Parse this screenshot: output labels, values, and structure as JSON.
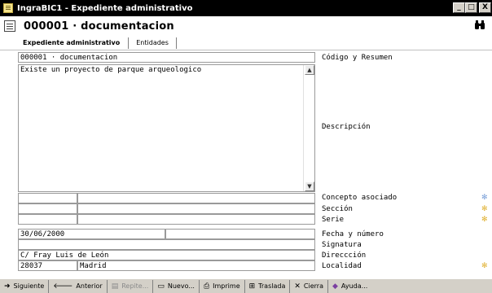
{
  "window": {
    "title": "IngraBIC1 - Expediente administrativo",
    "buttons": [
      "_",
      "□",
      "X"
    ]
  },
  "header": {
    "title": "000001 · documentacion",
    "search_icon": "binoculars-icon"
  },
  "tabs": [
    {
      "label": "Expediente administrativo",
      "active": true
    },
    {
      "label": "Entidades",
      "active": false
    }
  ],
  "fields": {
    "codigo_resumen": "000001 · documentacion",
    "descripcion": "Existe un proyecto de parque arqueologico",
    "concepto_a": "",
    "concepto_b": "",
    "seccion_a": "",
    "seccion_b": "",
    "serie_a": "",
    "serie_b": "",
    "fecha": "30/06/2000",
    "numero": "",
    "signatura": "",
    "direccion": "C/ Fray Luis de León",
    "cp": "28037",
    "localidad": "Madrid"
  },
  "labels": {
    "codigo_resumen": "Código y Resumen",
    "descripcion": "Descripción",
    "concepto": "Concepto asociado",
    "seccion": "Sección",
    "serie": "Serie",
    "fecha": "Fecha y número",
    "signatura": "Signatura",
    "direccion": "Direccción",
    "localidad": "Localidad"
  },
  "toolbar": [
    {
      "label": "Siguiente",
      "icon": "arrow-right-icon",
      "glyph": "➜",
      "disabled": false
    },
    {
      "label": "Anterior",
      "icon": "arrow-left-icon",
      "glyph": "🡐",
      "disabled": false
    },
    {
      "label": "Repite...",
      "icon": "repeat-icon",
      "glyph": "▤",
      "disabled": true
    },
    {
      "label": "Nuevo...",
      "icon": "new-icon",
      "glyph": "▭",
      "disabled": false
    },
    {
      "label": "Imprime",
      "icon": "printer-icon",
      "glyph": "⎙",
      "disabled": false
    },
    {
      "label": "Traslada",
      "icon": "move-icon",
      "glyph": "⊞",
      "disabled": false
    },
    {
      "label": "Cierra",
      "icon": "close-x-icon",
      "glyph": "✕",
      "disabled": false
    },
    {
      "label": "Ayuda...",
      "icon": "help-book-icon",
      "glyph": "◆",
      "disabled": false
    }
  ],
  "colors": {
    "titlebar": "#000000",
    "toolbar": "#d4d0c8",
    "required_star": "#e0b030",
    "link_star": "#7aa0d8"
  }
}
